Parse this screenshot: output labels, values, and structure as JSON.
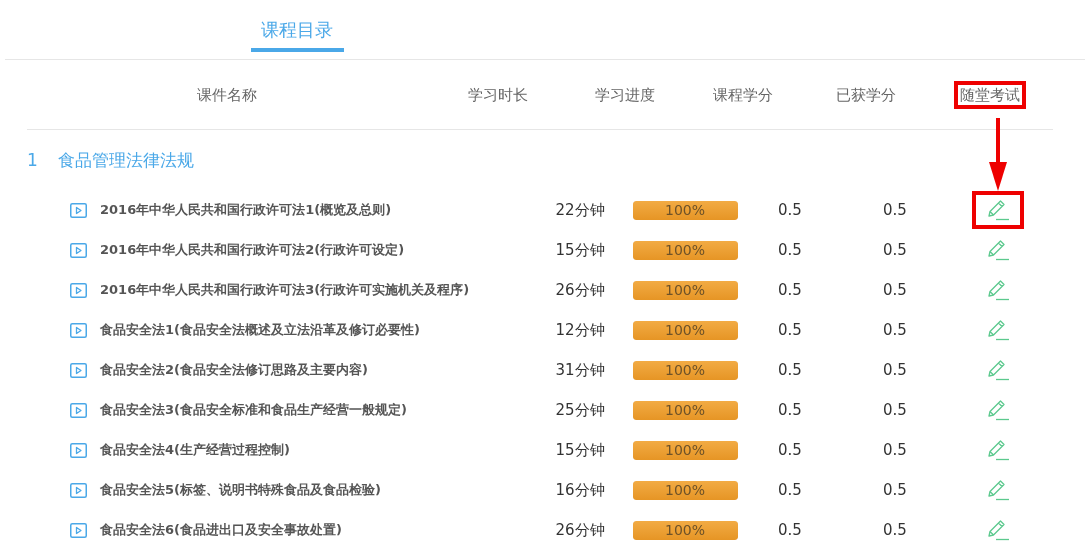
{
  "tabs": [
    {
      "label": "课程目录",
      "selected": true
    }
  ],
  "columns": [
    {
      "label": "课件名称",
      "highlighted": false
    },
    {
      "label": "学习时长",
      "highlighted": false
    },
    {
      "label": "学习进度",
      "highlighted": false
    },
    {
      "label": "课程学分",
      "highlighted": false
    },
    {
      "label": "已获学分",
      "highlighted": false
    },
    {
      "label": "随堂考试",
      "highlighted": true
    }
  ],
  "annotation_arrow": true,
  "sections": [
    {
      "number": "1",
      "title": "食品管理法律法规",
      "lessons": [
        {
          "title": "2016年中华人民共和国行政许可法1(概览及总则)",
          "duration": "22分钟",
          "level": 1,
          "reading": "100%",
          "credit": "0.5",
          "earned": "0.5",
          "exam_highlighted": true
        },
        {
          "title": "2016年中华人民共和国行政许可法2(行政许可设定)",
          "duration": "15分钟",
          "level": 1,
          "reading": "100%",
          "credit": "0.5",
          "earned": "0.5",
          "exam_highlighted": false
        },
        {
          "title": "2016年中华人民共和国行政许可法3(行政许可实施机关及程序)",
          "duration": "26分钟",
          "level": 1,
          "reading": "100%",
          "credit": "0.5",
          "earned": "0.5",
          "exam_highlighted": false
        },
        {
          "title": "食品安全法1(食品安全法概述及立法沿革及修订必要性)",
          "duration": "12分钟",
          "level": 1,
          "reading": "100%",
          "credit": "0.5",
          "earned": "0.5",
          "exam_highlighted": false
        },
        {
          "title": "食品安全法2(食品安全法修订思路及主要内容)",
          "duration": "31分钟",
          "level": 1,
          "reading": "100%",
          "credit": "0.5",
          "earned": "0.5",
          "exam_highlighted": false
        },
        {
          "title": "食品安全法3(食品安全标准和食品生产经营一般规定)",
          "duration": "25分钟",
          "level": 1,
          "reading": "100%",
          "credit": "0.5",
          "earned": "0.5",
          "exam_highlighted": false
        },
        {
          "title": "食品安全法4(生产经营过程控制)",
          "duration": "15分钟",
          "level": 1,
          "reading": "100%",
          "credit": "0.5",
          "earned": "0.5",
          "exam_highlighted": false
        },
        {
          "title": "食品安全法5(标签、说明书特殊食品及食品检验)",
          "duration": "16分钟",
          "level": 1,
          "reading": "100%",
          "credit": "0.5",
          "earned": "0.5",
          "exam_highlighted": false
        },
        {
          "title": "食品安全法6(食品进出口及安全事故处置)",
          "duration": "26分钟",
          "level": 1,
          "reading": "100%",
          "credit": "0.5",
          "earned": "0.5",
          "exam_highlighted": false
        }
      ]
    }
  ]
}
